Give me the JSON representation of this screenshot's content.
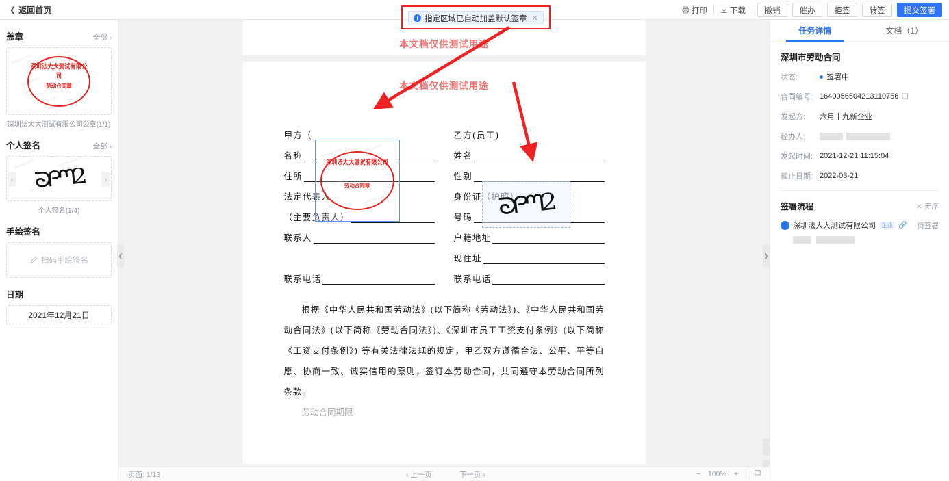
{
  "topbar": {
    "back_label": "返回首页",
    "print_label": "打印",
    "download_label": "下载",
    "buttons": [
      {
        "label": "撤销",
        "primary": false
      },
      {
        "label": "催办",
        "primary": false
      },
      {
        "label": "拒签",
        "primary": false
      },
      {
        "label": "转签",
        "primary": false
      },
      {
        "label": "提交签署",
        "primary": true
      }
    ]
  },
  "toast": {
    "message": "指定区域已自动加盖默认签章",
    "close": "✕",
    "info_glyph": "i"
  },
  "sidebar": {
    "seal_section": {
      "title": "盖章",
      "all_label": "全部 ›",
      "seal_company": "深圳法大大测试有限公司",
      "seal_center": "劳动合同章",
      "caption": "深圳法大大测试有限公司公章(1/1)"
    },
    "personal_section": {
      "title": "个人签名",
      "all_label": "全部 ›",
      "caption": "个人签名(1/4)",
      "prev": "‹",
      "next": "›"
    },
    "draw_section": {
      "title": "手绘签名",
      "placeholder": "扫码手绘签名"
    },
    "date_section": {
      "title": "日期",
      "value": "2021年12月21日"
    }
  },
  "document": {
    "watermark": "本文档仅供测试用途",
    "left_fields": [
      {
        "label": "甲方（",
        "line": true
      },
      {
        "label": "名称",
        "line": true
      },
      {
        "label": "住所",
        "line": true
      },
      {
        "label": "法定代表人",
        "line": false
      },
      {
        "label": "（主要负责人）",
        "line": true
      },
      {
        "label": "联系人",
        "line": true
      },
      {
        "label": "",
        "line": false
      },
      {
        "label": "联系电话",
        "line": true
      }
    ],
    "right_fields": [
      {
        "label": "乙方(员工)",
        "line": false
      },
      {
        "label": "姓名",
        "line": true
      },
      {
        "label": "性别",
        "line": true
      },
      {
        "label": "身份证（护照）",
        "line": false
      },
      {
        "label": "号码",
        "line": true
      },
      {
        "label": "户籍地址",
        "line": true
      },
      {
        "label": "现住址",
        "line": true
      },
      {
        "label": "联系电话",
        "line": true
      }
    ],
    "paragraph": "根据《中华人民共和国劳动法》(以下简称《劳动法》)、《中华人民共和国劳动合同法》(以下简称《劳动合同法》)、《深圳市员工工资支付条例》(以下简称《工资支付条例》) 等有关法律法规的规定，甲乙双方遵循合法、公平、平等自愿、协商一致、诚实信用的原则，签订本劳动合同，共同遵守本劳动合同所列条款。",
    "next_heading": "劳动合同期限"
  },
  "bottombar": {
    "page_label": "页面:",
    "page_value": "1/13",
    "prev_page": "‹ 上一页",
    "next_page": "下一页 ›",
    "zoom_out": "−",
    "zoom_level": "100%",
    "zoom_in": "+",
    "fit_icon": "fit-screen-icon"
  },
  "right_panel": {
    "tabs": [
      {
        "label": "任务详情",
        "active": true
      },
      {
        "label": "文档（1）",
        "active": false
      }
    ],
    "doc_title": "深圳市劳动合同",
    "fields": [
      {
        "key": "状态:",
        "value": "签署中",
        "type": "status"
      },
      {
        "key": "合同编号:",
        "value": "1640056504213110756",
        "type": "copy"
      },
      {
        "key": "发起方:",
        "value": "六月十九新企业",
        "type": "text"
      },
      {
        "key": "经办人:",
        "value": "",
        "type": "redacted"
      },
      {
        "key": "发起时间:",
        "value": "2021-12-21 11:15:04",
        "type": "text"
      },
      {
        "key": "截止日期:",
        "value": "2022-03-21",
        "type": "text"
      }
    ],
    "flow": {
      "title": "签署流程",
      "order_label": "无序",
      "signer_name": "深圳法大大测试有限公司",
      "signer_badge": "企业",
      "signer_status": "待签署"
    }
  },
  "colors": {
    "accent": "#2f74f4",
    "seal_red": "#e4221f",
    "annotation_red": "#ee2222",
    "watermark_red": "#f07070"
  }
}
